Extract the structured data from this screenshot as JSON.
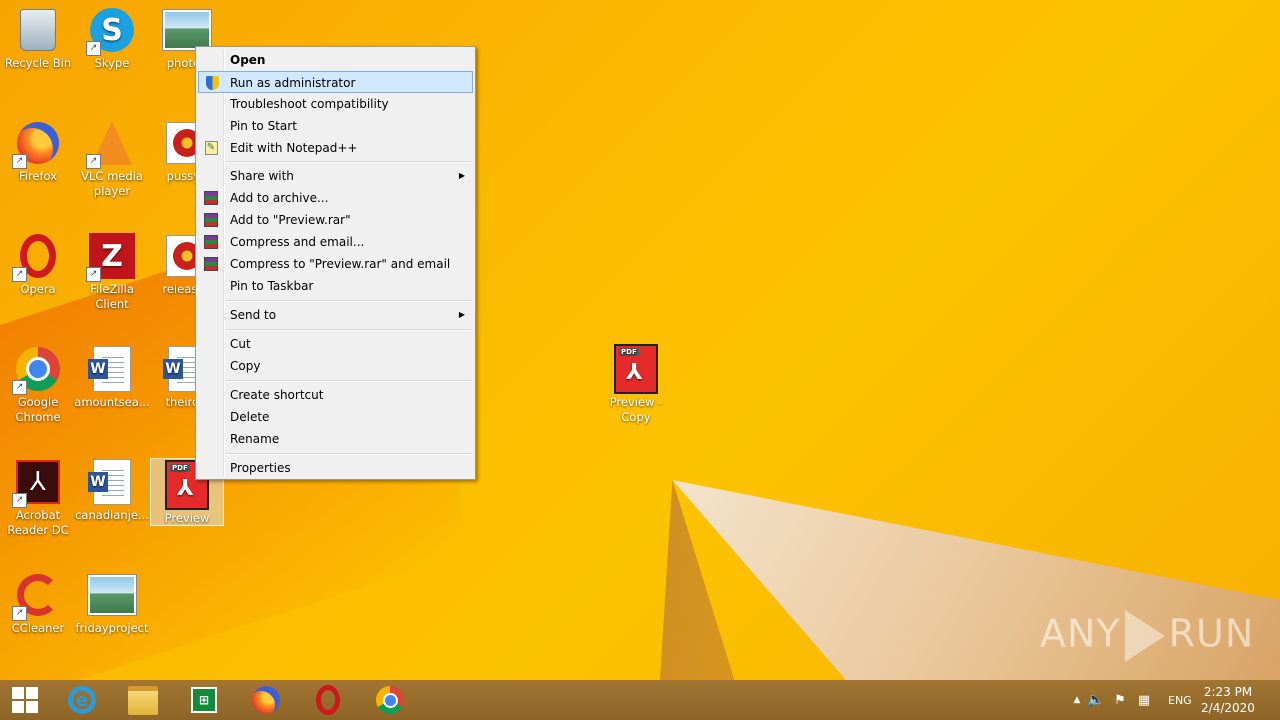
{
  "desktop": {
    "icons": [
      {
        "label": "Recycle Bin",
        "icon": "recycle-bin-icon"
      },
      {
        "label": "Skype",
        "icon": "skype-icon"
      },
      {
        "label": "photog",
        "icon": "image-file-icon"
      },
      {
        "label": "Firefox",
        "icon": "firefox-icon"
      },
      {
        "label": "VLC media player",
        "icon": "vlc-icon"
      },
      {
        "label": "pussyb",
        "icon": "image-file-icon"
      },
      {
        "label": "Opera",
        "icon": "opera-icon"
      },
      {
        "label": "FileZilla Client",
        "icon": "filezilla-icon"
      },
      {
        "label": "released",
        "icon": "image-file-icon"
      },
      {
        "label": "Google Chrome",
        "icon": "chrome-icon"
      },
      {
        "label": "amountsea...",
        "icon": "word-document-icon"
      },
      {
        "label": "theirdis",
        "icon": "word-document-icon"
      },
      {
        "label": "Acrobat Reader DC",
        "icon": "acrobat-icon"
      },
      {
        "label": "canadianje...",
        "icon": "word-document-icon"
      },
      {
        "label": "Preview",
        "icon": "pdf-file-icon"
      },
      {
        "label": "CCleaner",
        "icon": "ccleaner-icon"
      },
      {
        "label": "fridayproject",
        "icon": "image-file-icon"
      },
      {
        "label": "Preview - Copy",
        "icon": "pdf-file-icon"
      }
    ]
  },
  "context_menu": {
    "items": [
      {
        "label": "Open"
      },
      {
        "label": "Run as administrator",
        "icon": "shield-icon"
      },
      {
        "label": "Troubleshoot compatibility"
      },
      {
        "label": "Pin to Start"
      },
      {
        "label": "Edit with Notepad++",
        "icon": "notepad-plus-plus-icon"
      },
      {
        "label": "Share with"
      },
      {
        "label": "Add to archive...",
        "icon": "winrar-icon"
      },
      {
        "label": "Add to \"Preview.rar\"",
        "icon": "winrar-icon"
      },
      {
        "label": "Compress and email...",
        "icon": "winrar-icon"
      },
      {
        "label": "Compress to \"Preview.rar\" and email",
        "icon": "winrar-icon"
      },
      {
        "label": "Pin to Taskbar"
      },
      {
        "label": "Send to"
      },
      {
        "label": "Cut"
      },
      {
        "label": "Copy"
      },
      {
        "label": "Create shortcut"
      },
      {
        "label": "Delete"
      },
      {
        "label": "Rename"
      },
      {
        "label": "Properties"
      }
    ]
  },
  "taskbar": {
    "pinned": [
      "windows-start-icon",
      "internet-explorer-icon",
      "file-explorer-icon",
      "store-icon",
      "firefox-icon",
      "opera-icon",
      "chrome-icon"
    ],
    "tray": {
      "language": "ENG",
      "time": "2:23 PM",
      "date": "2/4/2020"
    }
  },
  "watermark": {
    "text_left": "ANY",
    "text_right": "RUN"
  },
  "colors": {
    "accent": "#fbb900",
    "menu_highlight": "#d1e8ff",
    "menu_highlight_border": "#84acdd"
  }
}
